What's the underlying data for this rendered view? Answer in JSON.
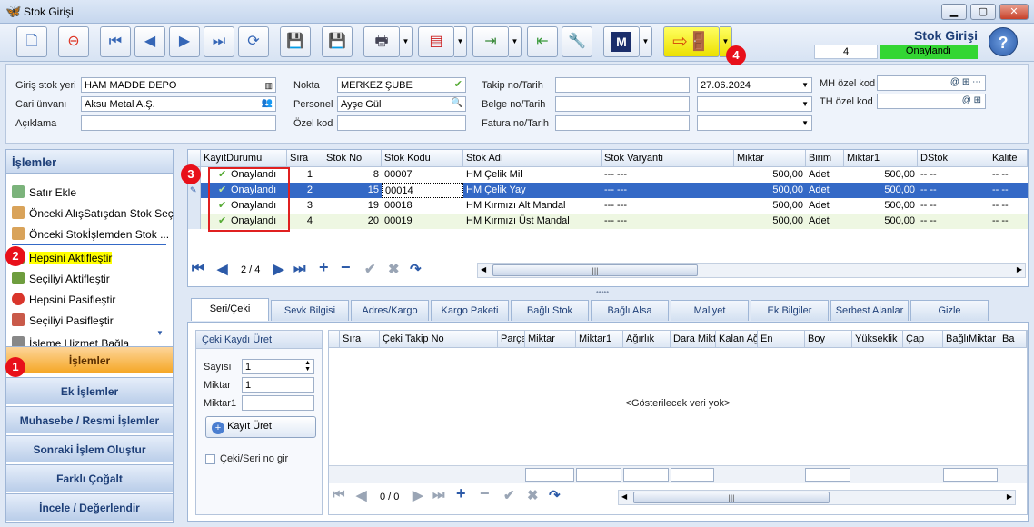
{
  "window": {
    "title": "Stok Girişi",
    "min": "▁",
    "max": "▢",
    "close": "✕"
  },
  "header": {
    "title": "Stok Girişi",
    "count": "4",
    "status": "Onaylandı",
    "status_color": "#33d633"
  },
  "form": {
    "giris_stok_yeri": {
      "label": "Giriş stok yeri",
      "value": "HAM MADDE DEPO"
    },
    "cari_unvani": {
      "label": "Cari ünvanı",
      "value": "Aksu Metal A.Ş."
    },
    "aciklama": {
      "label": "Açıklama",
      "value": ""
    },
    "nokta": {
      "label": "Nokta",
      "value": "MERKEZ ŞUBE"
    },
    "personel": {
      "label": "Personel",
      "value": "Ayşe Gül"
    },
    "ozel_kod": {
      "label": "Özel kod",
      "value": ""
    },
    "takip_no": {
      "label": "Takip no/Tarih",
      "value": "",
      "date": "27.06.2024"
    },
    "belge_no": {
      "label": "Belge no/Tarih",
      "value": ""
    },
    "fatura_no": {
      "label": "Fatura no/Tarih",
      "value": ""
    },
    "mh_ozel_kod": {
      "label": "MH özel kod",
      "value": ""
    },
    "th_ozel_kod": {
      "label": "TH özel kod",
      "value": ""
    }
  },
  "left": {
    "title": "İşlemler",
    "items": [
      "Satır Ekle",
      "Önceki AlışSatışdan Stok Seç",
      "Önceki Stokİşlemden Stok ...",
      "Hepsini Aktifleştir",
      "Seçiliyi Aktifleştir",
      "Hepsini Pasifleştir",
      "Seçiliyi Pasifleştir",
      "İşleme Hizmet Bağla"
    ],
    "nav": [
      "İşlemler",
      "Ek İşlemler",
      "Muhasebe / Resmi İşlemler",
      "Sonraki İşlem Oluştur",
      "Farklı Çoğalt",
      "İncele / Değerlendir"
    ]
  },
  "grid": {
    "headers": [
      "KayıtDurumu",
      "Sıra",
      "Stok No",
      "Stok Kodu",
      "Stok Adı",
      "Stok Varyantı",
      "Miktar",
      "Birim",
      "Miktar1",
      "DStok",
      "Kalite"
    ],
    "rows": [
      {
        "durum": "Onaylandı",
        "sira": "1",
        "stokno": "8",
        "kod": "00007",
        "ad": "HM Çelik Mil",
        "varyant": "--- ---",
        "miktar": "500,00",
        "birim": "Adet",
        "miktar1": "500,00",
        "dstok": "-- --",
        "kalite": "-- --"
      },
      {
        "durum": "Onaylandı",
        "sira": "2",
        "stokno": "15",
        "kod": "00014",
        "ad": "HM Çelik Yay",
        "varyant": "--- ---",
        "miktar": "500,00",
        "birim": "Adet",
        "miktar1": "500,00",
        "dstok": "-- --",
        "kalite": "-- --"
      },
      {
        "durum": "Onaylandı",
        "sira": "3",
        "stokno": "19",
        "kod": "00018",
        "ad": "HM Kırmızı Alt Mandal",
        "varyant": "--- ---",
        "miktar": "500,00",
        "birim": "Adet",
        "miktar1": "500,00",
        "dstok": "-- --",
        "kalite": "-- --"
      },
      {
        "durum": "Onaylandı",
        "sira": "4",
        "stokno": "20",
        "kod": "00019",
        "ad": "HM Kırmızı Üst Mandal",
        "varyant": "--- ---",
        "miktar": "500,00",
        "birim": "Adet",
        "miktar1": "500,00",
        "dstok": "-- --",
        "kalite": "-- --"
      }
    ],
    "pager": "2 / 4"
  },
  "tabs": [
    "Seri/Çeki",
    "Sevk Bilgisi",
    "Adres/Kargo",
    "Kargo Paketi",
    "Bağlı Stok",
    "Bağlı Alsa",
    "Maliyet",
    "Ek Bilgiler",
    "Serbest Alanlar",
    "Gizle"
  ],
  "ceki": {
    "title": "Çeki Kaydı Üret",
    "sayisi_label": "Sayısı",
    "sayisi": "1",
    "miktar_label": "Miktar",
    "miktar": "1",
    "miktar1_label": "Miktar1",
    "miktar1": "",
    "button": "Kayıt Üret",
    "checkbox": "Çeki/Seri no gir"
  },
  "subgrid": {
    "headers": [
      "Sıra",
      "Çeki Takip No",
      "Parça",
      "Miktar",
      "Miktar1",
      "Ağırlık",
      "Dara Mikt",
      "Kalan Ağ",
      "En",
      "Boy",
      "Yükseklik",
      "Çap",
      "BağlıMiktar",
      "Ba"
    ],
    "empty": "<Gösterilecek veri yok>",
    "pager": "0 / 0"
  },
  "badges": [
    "1",
    "2",
    "3",
    "4"
  ]
}
